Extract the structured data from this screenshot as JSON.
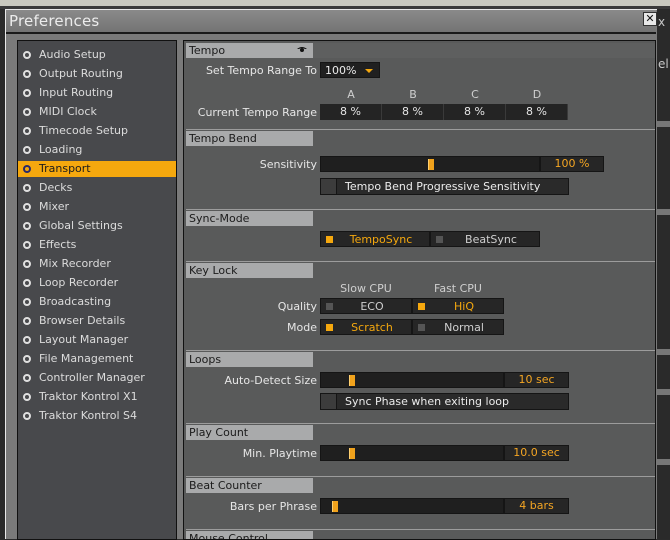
{
  "window": {
    "title": "Preferences",
    "close_label": "✕"
  },
  "background": {
    "right_text_1": "x",
    "right_text_2": "el"
  },
  "sidebar": {
    "items": [
      {
        "label": "Audio Setup",
        "active": false
      },
      {
        "label": "Output Routing",
        "active": false
      },
      {
        "label": "Input Routing",
        "active": false
      },
      {
        "label": "MIDI Clock",
        "active": false
      },
      {
        "label": "Timecode Setup",
        "active": false
      },
      {
        "label": "Loading",
        "active": false
      },
      {
        "label": "Transport",
        "active": true
      },
      {
        "label": "Decks",
        "active": false
      },
      {
        "label": "Mixer",
        "active": false
      },
      {
        "label": "Global Settings",
        "active": false
      },
      {
        "label": "Effects",
        "active": false
      },
      {
        "label": "Mix Recorder",
        "active": false
      },
      {
        "label": "Loop Recorder",
        "active": false
      },
      {
        "label": "Broadcasting",
        "active": false
      },
      {
        "label": "Browser Details",
        "active": false
      },
      {
        "label": "Layout Manager",
        "active": false
      },
      {
        "label": "File Management",
        "active": false
      },
      {
        "label": "Controller Manager",
        "active": false
      },
      {
        "label": "Traktor Kontrol X1",
        "active": false
      },
      {
        "label": "Traktor Kontrol S4",
        "active": false
      }
    ]
  },
  "colors": {
    "accent": "#f5a80e",
    "panel_bg": "#595a5a",
    "sidebar_bg": "#48494c",
    "section_header_bg": "#a9aaab"
  },
  "tempo": {
    "header": "Tempo",
    "set_range_label": "Set Tempo Range To",
    "set_range_value": "100%",
    "current_range_label": "Current Tempo Range",
    "decks": [
      {
        "name": "A",
        "value": "8 %"
      },
      {
        "name": "B",
        "value": "8 %"
      },
      {
        "name": "C",
        "value": "8 %"
      },
      {
        "name": "D",
        "value": "8 %"
      }
    ]
  },
  "tempo_bend": {
    "header": "Tempo Bend",
    "sensitivity_label": "Sensitivity",
    "sensitivity_value": "100 %",
    "sensitivity_fraction": 0.5,
    "progressive_label": "Tempo Bend Progressive Sensitivity",
    "progressive_checked": false
  },
  "sync_mode": {
    "header": "Sync-Mode",
    "options": [
      {
        "label": "TempoSync",
        "selected": true
      },
      {
        "label": "BeatSync",
        "selected": false
      }
    ]
  },
  "key_lock": {
    "header": "Key Lock",
    "col_slow": "Slow CPU",
    "col_fast": "Fast CPU",
    "quality_label": "Quality",
    "quality_options": [
      {
        "label": "ECO",
        "selected": false
      },
      {
        "label": "HiQ",
        "selected": true
      }
    ],
    "mode_label": "Mode",
    "mode_options": [
      {
        "label": "Scratch",
        "selected": true
      },
      {
        "label": "Normal",
        "selected": false
      }
    ]
  },
  "loops": {
    "header": "Loops",
    "auto_detect_label": "Auto-Detect Size",
    "auto_detect_value": "10 sec",
    "auto_detect_fraction": 0.15,
    "sync_phase_label": "Sync Phase when exiting loop",
    "sync_phase_checked": false
  },
  "play_count": {
    "header": "Play Count",
    "min_playtime_label": "Min. Playtime",
    "min_playtime_value": "10.0 sec",
    "min_playtime_fraction": 0.15
  },
  "beat_counter": {
    "header": "Beat Counter",
    "bars_label": "Bars per Phrase",
    "bars_value": "4 bars",
    "bars_fraction": 0.05
  },
  "mouse_control": {
    "header": "Mouse Control"
  }
}
